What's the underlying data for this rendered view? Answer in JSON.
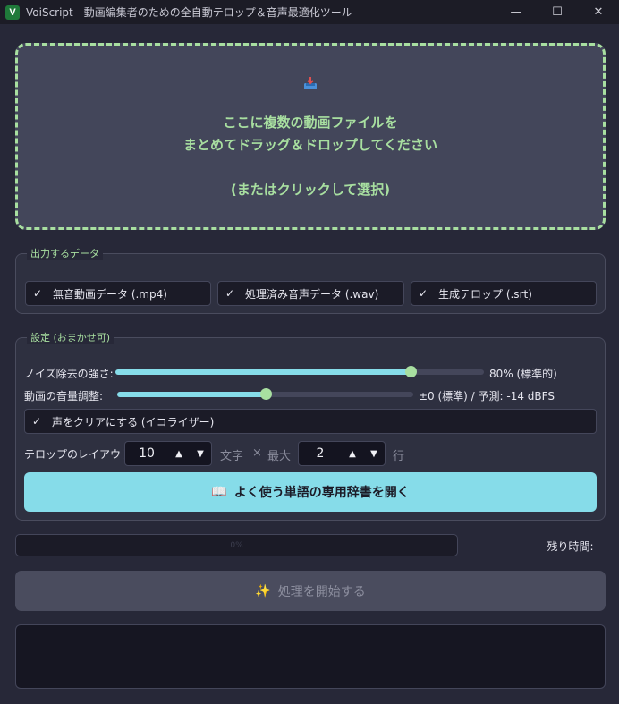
{
  "window": {
    "title": "VoiScript - 動画編集者のための全自動テロップ＆音声最適化ツール",
    "app_icon": "V",
    "minimize": "—",
    "maximize": "☐",
    "close": "✕"
  },
  "dropzone": {
    "icon": "inbox-tray-icon",
    "line1": "ここに複数の動画ファイルを",
    "line2": "まとめてドラッグ＆ドロップしてください",
    "line3": "(またはクリックして選択)"
  },
  "output": {
    "title": "出力するデータ",
    "options": [
      {
        "label": "無音動画データ (.mp4)",
        "checked": true
      },
      {
        "label": "処理済み音声データ (.wav)",
        "checked": true
      },
      {
        "label": "生成テロップ (.srt)",
        "checked": true
      }
    ]
  },
  "settings": {
    "title": "設定 (おまかせ可)",
    "noise": {
      "label": "ノイズ除去の強さ:",
      "value_text": "80% (標準的)",
      "fraction": 0.8
    },
    "volume": {
      "label": "動画の音量調整:",
      "value_text": "±0 (標準) / 予測: -14 dBFS",
      "fraction": 0.5
    },
    "eq": {
      "label": "声をクリアにする (イコライザー)",
      "checked": true
    },
    "layout": {
      "label": "テロップのレイアウト:",
      "chars": "10",
      "chars_unit": "文字",
      "times": "×",
      "max_label": "最大",
      "lines": "2",
      "lines_unit": "行"
    },
    "dict_button": "よく使う単語の専用辞書を開く",
    "dict_icon": "📖"
  },
  "progress": {
    "text": "0%",
    "percent": 0
  },
  "remaining": "残り時間: --",
  "start_button": "処理を開始する",
  "start_icon": "✨",
  "colors": {
    "accent_green": "#a8dfa0",
    "accent_cyan": "#86dce9",
    "background": "#272838"
  }
}
